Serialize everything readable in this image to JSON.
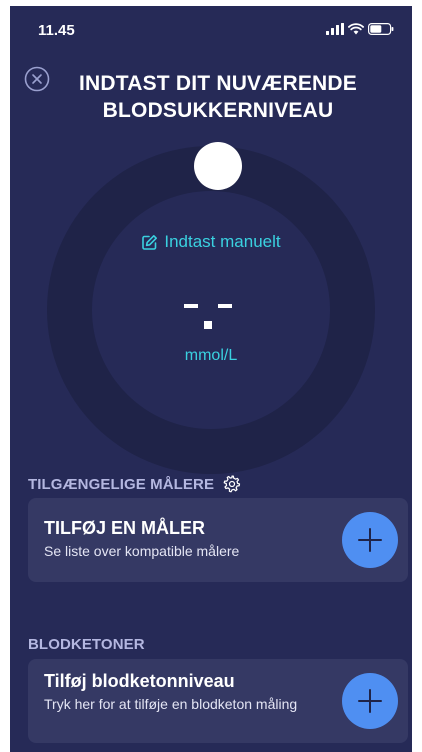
{
  "status_bar": {
    "time": "11.45"
  },
  "header": {
    "title": "INDTAST DIT NUVÆRENDE BLODSUKKERNIVEAU"
  },
  "dial": {
    "manual_entry_label": "Indtast manuelt",
    "value_display": "-.-",
    "unit": "mmol/L"
  },
  "meters": {
    "section_title": "TILGÆNGELIGE MÅLERE",
    "card_title": "TILFØJ EN MÅLER",
    "card_subtitle": "Se liste over kompatible målere"
  },
  "ketones": {
    "section_title": "BLODKETONER",
    "card_title": "Tilføj blodketonniveau",
    "card_subtitle": "Tryk her for at tilføje en blodketon måling"
  },
  "colors": {
    "background": "#262a57",
    "dial_ring": "#1f2348",
    "card": "#353964",
    "accent_cyan": "#3ad1e0",
    "button_blue": "#4f8ff2",
    "section_label": "#b4b7e0"
  },
  "icons": {
    "close": "close-circle-icon",
    "edit": "edit-pencil-icon",
    "settings": "gear-icon",
    "add": "plus-icon",
    "signal": "cellular-signal-icon",
    "wifi": "wifi-icon",
    "battery": "battery-icon"
  }
}
